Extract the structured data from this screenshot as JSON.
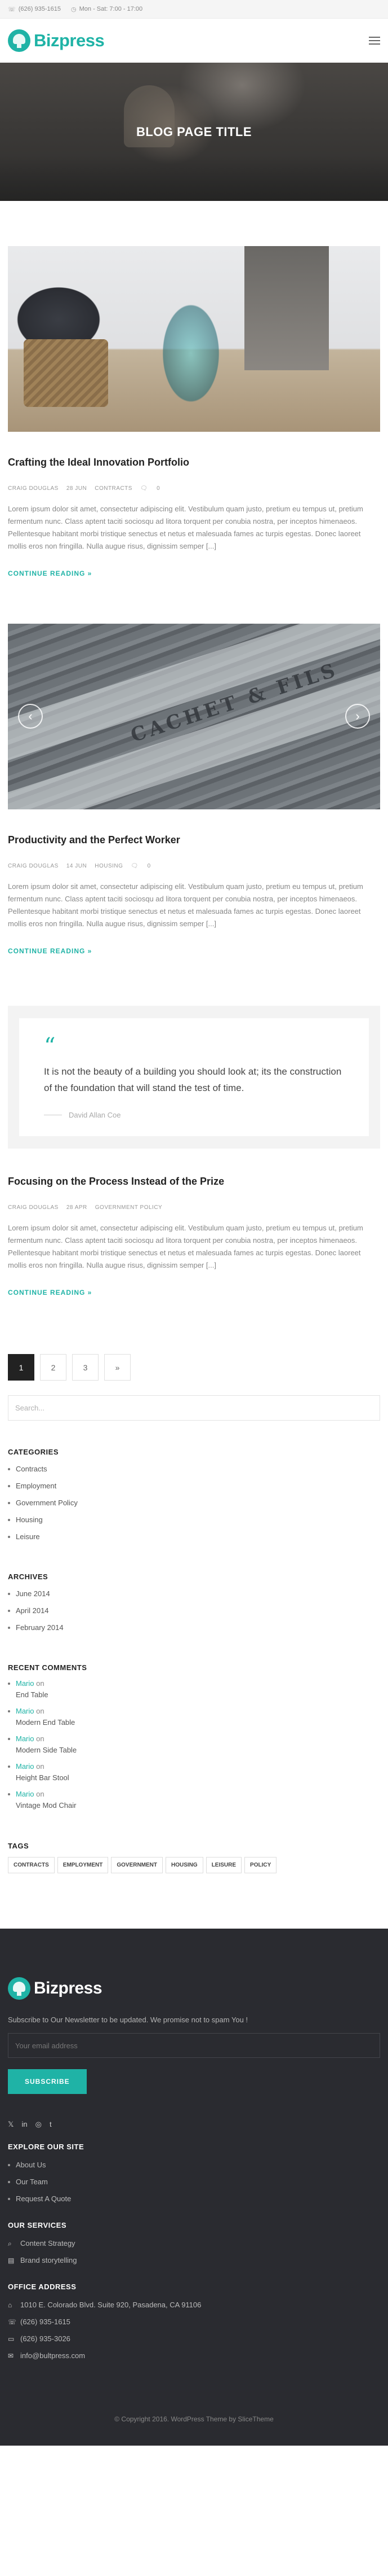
{
  "topbar": {
    "phone": "(626) 935-1615",
    "hours": "Mon - Sat: 7:00 - 17:00"
  },
  "brand": {
    "name": "Bizpress"
  },
  "hero": {
    "title": "BLOG PAGE TITLE"
  },
  "posts": [
    {
      "title": "Crafting the Ideal Innovation Portfolio",
      "author": "CRAIG DOUGLAS",
      "date": "28 JUN",
      "category": "CONTRACTS",
      "comments": "0",
      "excerpt": "Lorem ipsum dolor sit amet, consectetur adipiscing elit. Vestibulum quam justo, pretium eu tempus ut, pretium fermentum nunc. Class aptent taciti sociosqu ad litora torquent per conubia nostra, per inceptos himenaeos. Pellentesque habitant morbi tristique senectus et netus et malesuada fames ac turpis egestas. Donec laoreet mollis eros non fringilla. Nulla augue risus, dignissim semper [...]",
      "read_more": "CONTINUE READING »"
    },
    {
      "title": "Productivity and the Perfect Worker",
      "author": "CRAIG DOUGLAS",
      "date": "14 JUN",
      "category": "HOUSING",
      "comments": "0",
      "image_text": "CACHET & FILS",
      "excerpt": "Lorem ipsum dolor sit amet, consectetur adipiscing elit. Vestibulum quam justo, pretium eu tempus ut, pretium fermentum nunc. Class aptent taciti sociosqu ad litora torquent per conubia nostra, per inceptos himenaeos. Pellentesque habitant morbi tristique senectus et netus et malesuada fames ac turpis egestas. Donec laoreet mollis eros non fringilla. Nulla augue risus, dignissim semper [...]",
      "read_more": "CONTINUE READING »"
    },
    {
      "title": "Focusing on the Process Instead of the Prize",
      "author": "CRAIG DOUGLAS",
      "date": "28 APR",
      "category": "GOVERNMENT POLICY",
      "excerpt": "Lorem ipsum dolor sit amet, consectetur adipiscing elit. Vestibulum quam justo, pretium eu tempus ut, pretium fermentum nunc. Class aptent taciti sociosqu ad litora torquent per conubia nostra, per inceptos himenaeos. Pellentesque habitant morbi tristique senectus et netus et malesuada fames ac turpis egestas. Donec laoreet mollis eros non fringilla. Nulla augue risus, dignissim semper [...]",
      "read_more": "CONTINUE READING »"
    }
  ],
  "quote": {
    "text": "It is not the beauty of a building you should look at; its the construction of the foundation that will stand the test of time.",
    "author": "David Allan Coe"
  },
  "pagination": [
    "1",
    "2",
    "3",
    "»"
  ],
  "search": {
    "placeholder": "Search..."
  },
  "categories": {
    "title": "CATEGORIES",
    "items": [
      "Contracts",
      "Employment",
      "Government Policy",
      "Housing",
      "Leisure"
    ]
  },
  "archives": {
    "title": "ARCHIVES",
    "items": [
      "June 2014",
      "April 2014",
      "February 2014"
    ]
  },
  "recent_comments": {
    "title": "RECENT COMMENTS",
    "on": "on",
    "items": [
      {
        "author": "Mario",
        "target": "End Table"
      },
      {
        "author": "Mario",
        "target": "Modern End Table"
      },
      {
        "author": "Mario",
        "target": "Modern Side Table"
      },
      {
        "author": "Mario",
        "target": "Height Bar Stool"
      },
      {
        "author": "Mario",
        "target": "Vintage Mod Chair"
      }
    ]
  },
  "tags": {
    "title": "TAGS",
    "items": [
      "CONTRACTS",
      "EMPLOYMENT",
      "GOVERNMENT",
      "HOUSING",
      "LEISURE",
      "POLICY"
    ]
  },
  "footer": {
    "subscribe_text": "Subscribe to Our Newsletter to be updated. We promise not to spam You !",
    "email_placeholder": "Your email address",
    "subscribe_button": "SUBSCRIBE",
    "social": [
      "𝕏",
      "in",
      "◎",
      "t"
    ],
    "explore_title": "EXPLORE OUR SITE",
    "explore_items": [
      "About Us",
      "Our Team",
      "Request A Quote"
    ],
    "services_title": "OUR SERVICES",
    "services_items": [
      "Content Strategy",
      "Brand storytelling"
    ],
    "office_title": "OFFICE ADDRESS",
    "office_items": [
      "1010 E. Colorado Blvd. Suite 920, Pasadena, CA 91106",
      "(626) 935-1615",
      "(626) 935-3026",
      "info@bultpress.com"
    ],
    "copyright": "© Copyright 2016. WordPress Theme by SliceTheme"
  },
  "colors": {
    "accent": "#1fb3a6",
    "footer_bg": "#2a2b30"
  }
}
